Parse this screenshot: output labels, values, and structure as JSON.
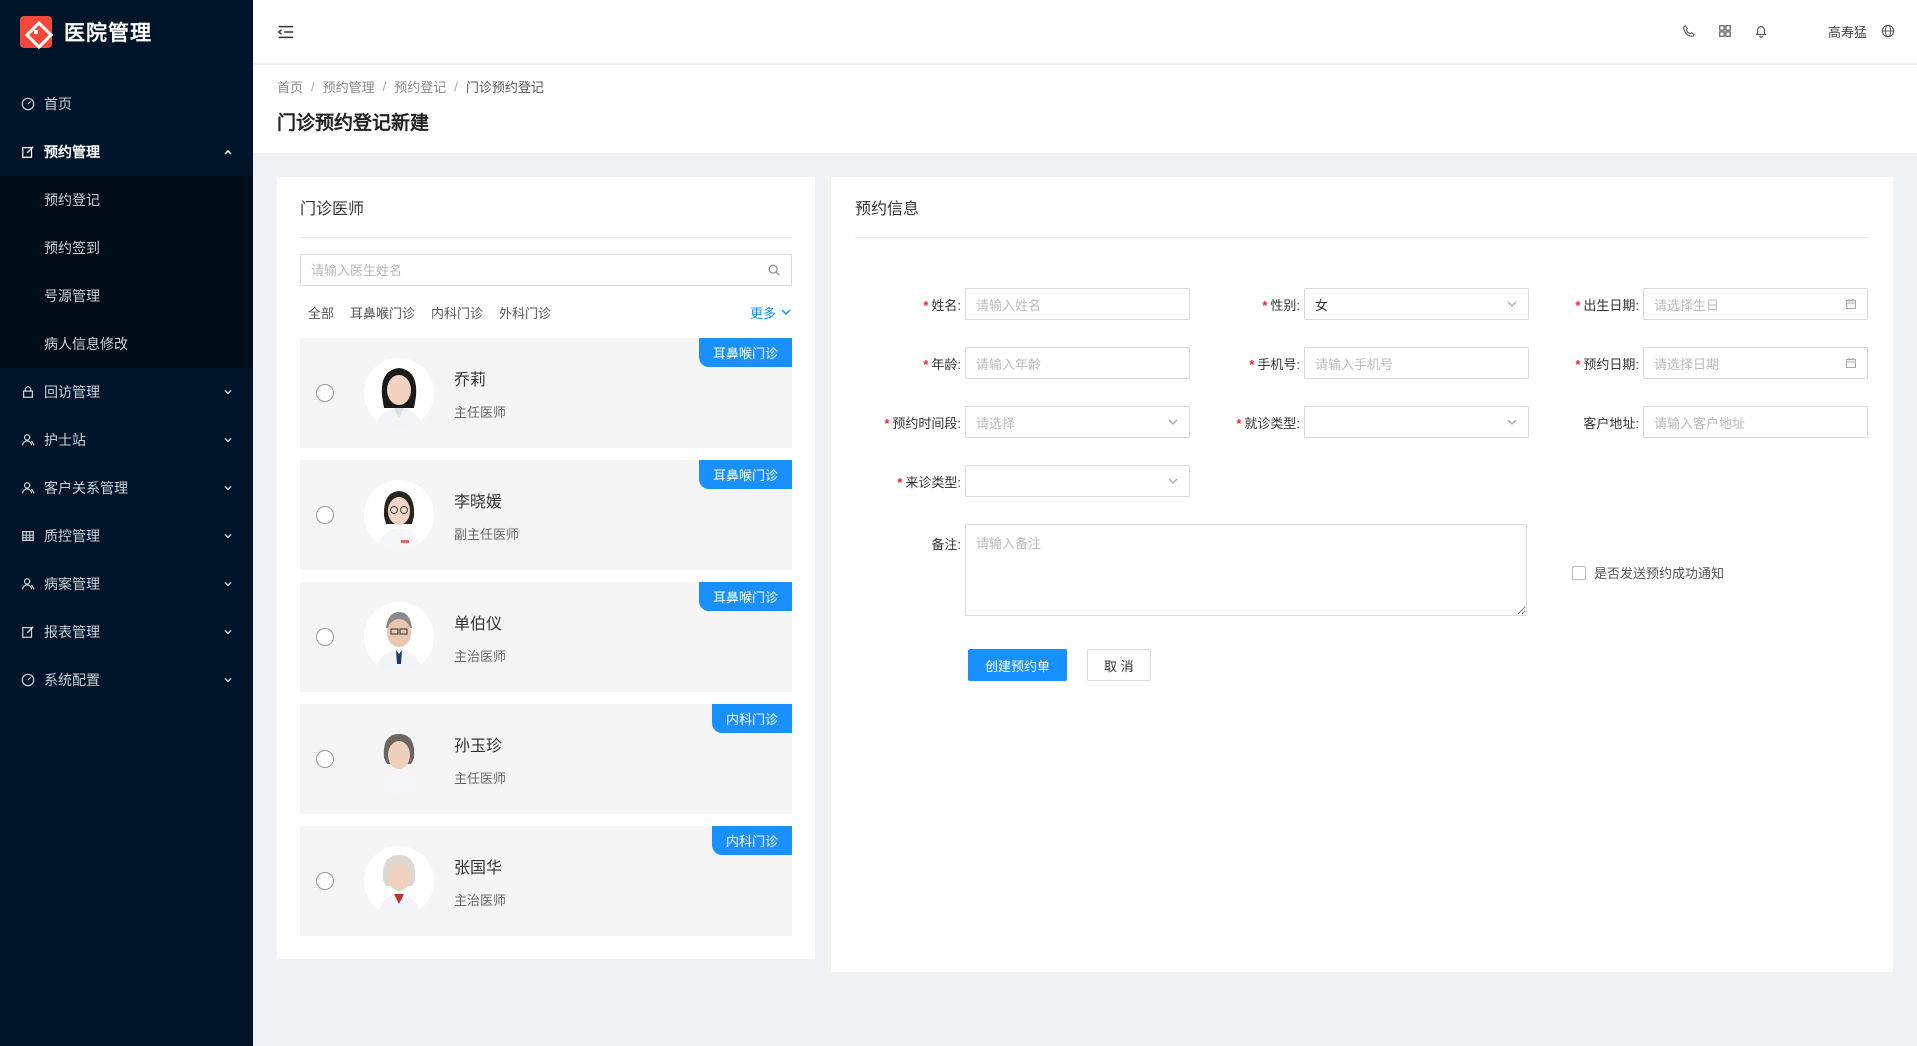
{
  "app": {
    "title": "医院管理"
  },
  "sidebar": {
    "items": [
      {
        "label": "首页",
        "icon": "dashboard-icon"
      },
      {
        "label": "预约管理",
        "icon": "edit-icon",
        "expanded": true,
        "children": [
          "预约登记",
          "预约签到",
          "号源管理",
          "病人信息修改"
        ]
      },
      {
        "label": "回访管理",
        "icon": "lock-icon"
      },
      {
        "label": "护士站",
        "icon": "user-icon"
      },
      {
        "label": "客户关系管理",
        "icon": "user-icon"
      },
      {
        "label": "质控管理",
        "icon": "table-icon"
      },
      {
        "label": "病案管理",
        "icon": "user-icon"
      },
      {
        "label": "报表管理",
        "icon": "edit-icon"
      },
      {
        "label": "系统配置",
        "icon": "dashboard-icon"
      }
    ]
  },
  "header": {
    "user": "高寿猛"
  },
  "breadcrumb": [
    "首页",
    "预约管理",
    "预约登记",
    "门诊预约登记"
  ],
  "page_title": "门诊预约登记新建",
  "doctors_panel": {
    "title": "门诊医师",
    "search_placeholder": "请输入医生姓名",
    "filters": [
      "全部",
      "耳鼻喉门诊",
      "内科门诊",
      "外科门诊"
    ],
    "more": "更多",
    "doctors": [
      {
        "name": "乔莉",
        "title": "主任医师",
        "dept": "耳鼻喉门诊",
        "avatar": "female"
      },
      {
        "name": "李晓媛",
        "title": "副主任医师",
        "dept": "耳鼻喉门诊",
        "avatar": "female-glasses"
      },
      {
        "name": "单伯仪",
        "title": "主治医师",
        "dept": "耳鼻喉门诊",
        "avatar": "male-glasses"
      },
      {
        "name": "孙玉珍",
        "title": "主任医师",
        "dept": "内科门诊",
        "avatar": "female-older"
      },
      {
        "name": "张国华",
        "title": "主治医师",
        "dept": "内科门诊",
        "avatar": "female-elder"
      }
    ]
  },
  "form": {
    "title": "预约信息",
    "name": {
      "label": "姓名:",
      "placeholder": "请输入姓名"
    },
    "gender": {
      "label": "性别:",
      "value": "女"
    },
    "birth": {
      "label": "出生日期:",
      "placeholder": "请选择生日"
    },
    "age": {
      "label": "年龄:",
      "placeholder": "请输入年龄"
    },
    "phone": {
      "label": "手机号:",
      "placeholder": "请输入手机号"
    },
    "date": {
      "label": "预约日期:",
      "placeholder": "请选择日期"
    },
    "period": {
      "label": "预约时间段:",
      "placeholder": "请选择"
    },
    "visit_type": {
      "label": "就诊类型:",
      "placeholder": ""
    },
    "address": {
      "label": "客户地址:",
      "placeholder": "请输入客户地址"
    },
    "come_type": {
      "label": "来诊类型:",
      "placeholder": ""
    },
    "remark": {
      "label": "备注:",
      "placeholder": "请输入备注"
    },
    "notify": {
      "label": "是否发送预约成功通知"
    },
    "submit": "创建预约单",
    "cancel": "取 消"
  },
  "colors": {
    "sidebar_bg": "#001529",
    "primary": "#1890ff",
    "required": "#f5222d",
    "logo": "#f5483b"
  }
}
